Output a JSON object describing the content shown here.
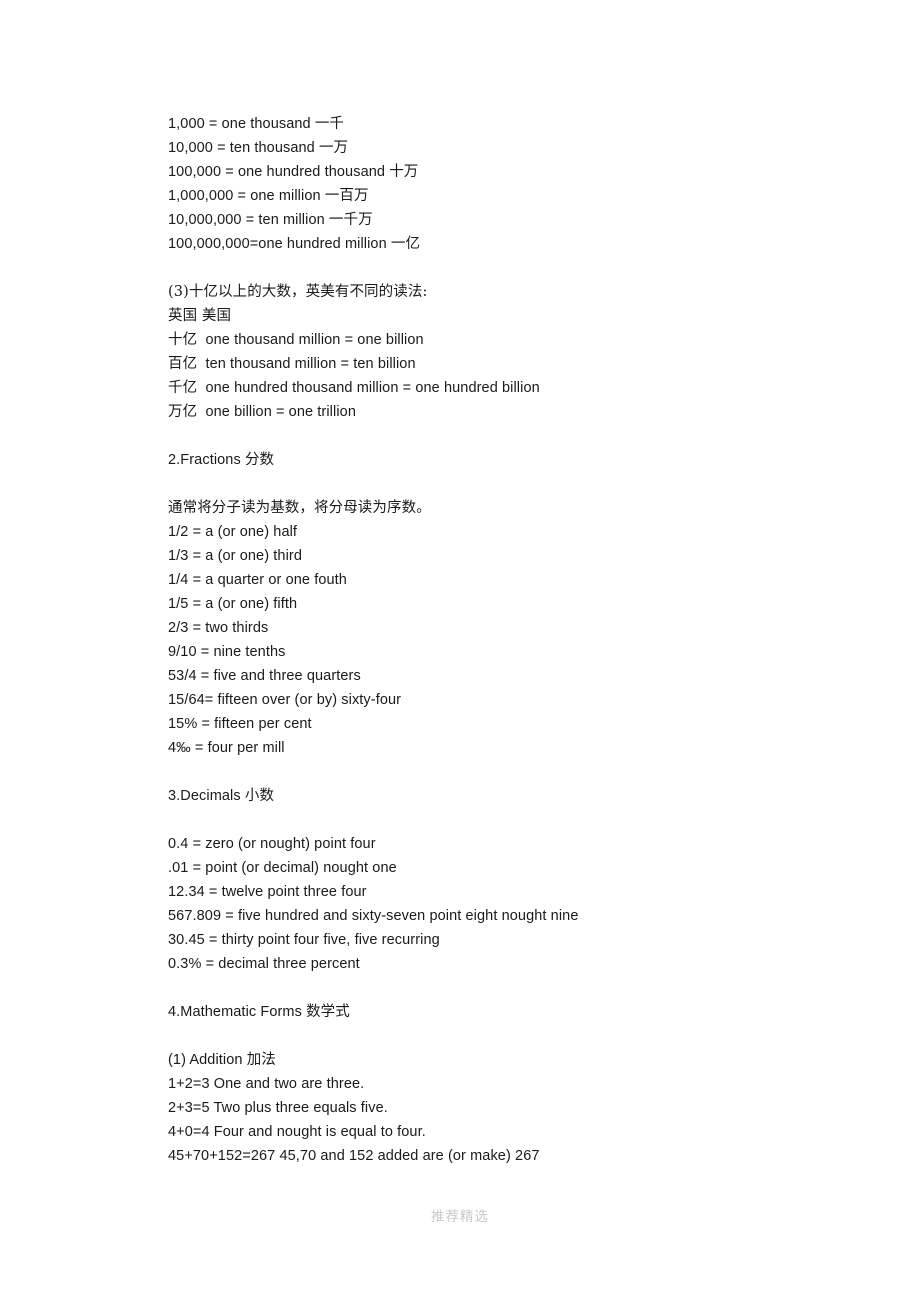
{
  "document": {
    "footer_watermark": "推荐精选",
    "blocks": [
      {
        "id": "large-numbers",
        "lines": [
          {
            "en": "1,000 = one thousand ",
            "cn": "一千"
          },
          {
            "en": "10,000 = ten thousand ",
            "cn": "一万"
          },
          {
            "en": "100,000 = one hundred thousand ",
            "cn": "十万"
          },
          {
            "en": "1,000,000 = one million ",
            "cn": "一百万"
          },
          {
            "en": "10,000,000 = ten million ",
            "cn": "一千万"
          },
          {
            "en": "100,000,000=one hundred million ",
            "cn": "一亿"
          }
        ]
      },
      {
        "id": "billions-uk-us",
        "lines": [
          {
            "en": "",
            "cn": "(3)十亿以上的大数，英美有不同的读法:"
          },
          {
            "en": "",
            "cn": "英国 美国"
          },
          {
            "cn": "十亿",
            "en": "  one thousand million = one billion"
          },
          {
            "cn": "百亿",
            "en": "  ten thousand million = ten billion"
          },
          {
            "cn": "千亿",
            "en": "  one hundred thousand million = one hundred billion"
          },
          {
            "cn": "万亿",
            "en": "  one billion = one trillion"
          }
        ],
        "cn_first": true
      },
      {
        "id": "fractions-heading",
        "lines": [
          {
            "en": "2.Fractions ",
            "cn": "分数"
          }
        ]
      },
      {
        "id": "fractions",
        "lines": [
          {
            "en": "",
            "cn": "通常将分子读为基数，将分母读为序数。"
          },
          {
            "en": "1/2 = a (or one) half",
            "cn": ""
          },
          {
            "en": "1/3 = a (or one) third",
            "cn": ""
          },
          {
            "en": "1/4 = a quarter or one fouth",
            "cn": ""
          },
          {
            "en": "1/5 = a (or one) fifth",
            "cn": ""
          },
          {
            "en": "2/3 = two thirds",
            "cn": ""
          },
          {
            "en": "9/10 = nine tenths",
            "cn": ""
          },
          {
            "en": "53/4 = five and three quarters",
            "cn": ""
          },
          {
            "en": "15/64= fifteen over (or by) sixty-four",
            "cn": ""
          },
          {
            "en": "15% = fifteen per cent",
            "cn": ""
          },
          {
            "en": "4‰ = four per mill",
            "cn": ""
          }
        ]
      },
      {
        "id": "decimals-heading",
        "lines": [
          {
            "en": "3.Decimals ",
            "cn": "小数"
          }
        ]
      },
      {
        "id": "decimals",
        "lines": [
          {
            "en": "0.4 = zero (or nought) point four",
            "cn": ""
          },
          {
            "en": ".01 = point (or decimal) nought one",
            "cn": ""
          },
          {
            "en": "12.34 = twelve point three four",
            "cn": ""
          },
          {
            "en": "567.809 = five hundred and sixty-seven point eight nought nine",
            "cn": ""
          },
          {
            "en": "30.45 = thirty point four five, five recurring",
            "cn": ""
          },
          {
            "en": "0.3% = decimal three percent",
            "cn": ""
          }
        ]
      },
      {
        "id": "math-forms-heading",
        "lines": [
          {
            "en": "4.Mathematic Forms ",
            "cn": "数学式"
          }
        ]
      },
      {
        "id": "addition",
        "lines": [
          {
            "en": "(1) Addition ",
            "cn": "加法"
          },
          {
            "en": "1+2=3 One and two are three.",
            "cn": ""
          },
          {
            "en": "2+3=5 Two plus three equals five.",
            "cn": ""
          },
          {
            "en": "4+0=4 Four and nought is equal to four.",
            "cn": ""
          },
          {
            "en": "45+70+152=267 45,70 and 152 added are (or make) 267",
            "cn": ""
          }
        ]
      }
    ]
  }
}
